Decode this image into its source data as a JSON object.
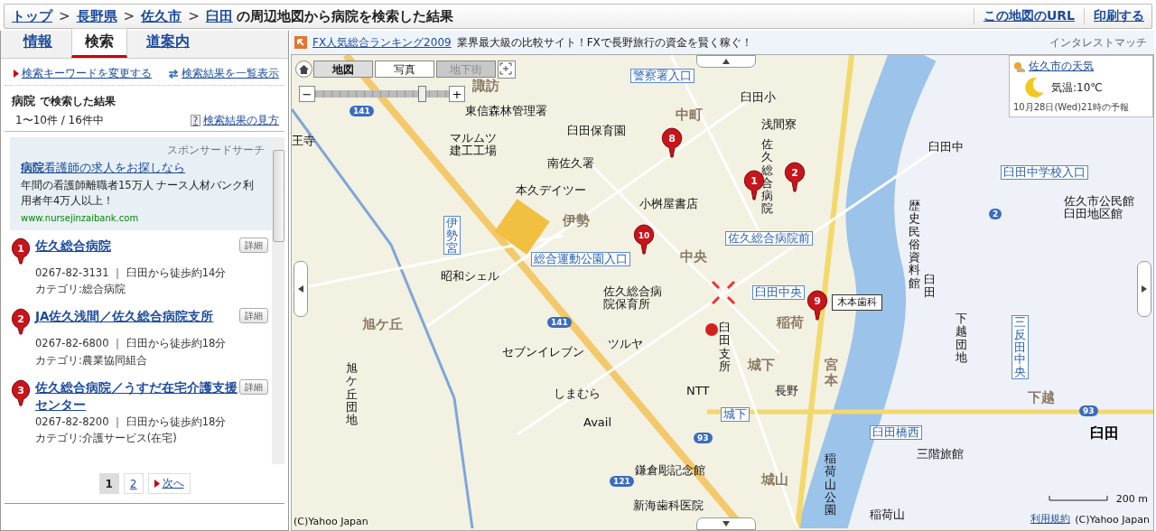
{
  "breadcrumb": {
    "crumbs": [
      {
        "kind": "link",
        "text": "トップ"
      },
      {
        "kind": "sep",
        "text": ">"
      },
      {
        "kind": "link",
        "text": "長野県"
      },
      {
        "kind": "sep",
        "text": ">"
      },
      {
        "kind": "link",
        "text": "佐久市"
      },
      {
        "kind": "sep",
        "text": ">"
      },
      {
        "kind": "link",
        "text": "臼田"
      }
    ],
    "title": "の周辺地図から病院を検索した結果",
    "links": [
      "この地図のURL",
      "印刷する"
    ]
  },
  "tabs": [
    {
      "label": "情報",
      "selected": false
    },
    {
      "label": "検索",
      "selected": true
    },
    {
      "label": "道案内",
      "selected": false
    }
  ],
  "panel_links": [
    "検索キーワードを変更する",
    "検索結果を一覧表示"
  ],
  "result_heading": {
    "keyword": "病院",
    "suffix": "で検索した結果"
  },
  "result_count": "1〜10件 / 16件中",
  "help_link": {
    "icon": "?",
    "text": "検索結果の見方"
  },
  "sponsored": {
    "label": "スポンサードサーチ",
    "title": "**病院**看護師の求人をお探しなら",
    "body": "年間の看護師離職者15万人 ナース人材バンク利用者年4万人以上！",
    "url": "www.nursejinzaibank.com"
  },
  "results": [
    {
      "number": "1",
      "name": "佐久総合病院",
      "contact": "0267-82-3131 ｜ 臼田から徒歩約14分",
      "category": "カテゴリ:総合病院",
      "detail": "詳細"
    },
    {
      "number": "2",
      "name": "JA佐久浅間／佐久総合病院支所",
      "contact": "0267-82-6800 ｜ 臼田から徒歩約18分",
      "category": "カテゴリ:農業協同組合",
      "detail": "詳細"
    },
    {
      "number": "3",
      "name": "佐久総合病院／うすだ在宅介護支援センター",
      "contact": "0267-82-8200 ｜ 臼田から徒歩約18分",
      "category": "カテゴリ:介護サービス(在宅)",
      "detail": "詳細"
    }
  ],
  "pagination": [
    {
      "label": "1",
      "selected": true,
      "kind": "page"
    },
    {
      "label": "2",
      "selected": false,
      "kind": "page"
    },
    {
      "label": "次へ",
      "selected": false,
      "kind": "next"
    }
  ],
  "ad_bar": {
    "link": "FX人気総合ランキング2009",
    "text": "業界最大級の比較サイト！FXで長野旅行の資金を賢く稼ぐ！",
    "source": "インタレストマッチ"
  },
  "map_modes": [
    {
      "label": "地図",
      "selected": true,
      "disabled": false
    },
    {
      "label": "写真",
      "selected": false,
      "disabled": false
    },
    {
      "label": "地下街",
      "selected": false,
      "disabled": true
    }
  ],
  "zoom": {
    "minus": "−",
    "plus": "+",
    "level": 0.8
  },
  "weather": {
    "link": "佐久市の天気",
    "temperature": "気温:10℃",
    "forecast": "10月28日(Wed)21時の予報"
  },
  "map_labels": [
    {
      "text": "諏訪",
      "kind": "area",
      "vertical": false
    },
    {
      "text": "警察署入口",
      "kind": "stop",
      "vertical": false
    },
    {
      "text": "中町",
      "kind": "area",
      "vertical": false
    },
    {
      "text": "東信森林管理署",
      "kind": "place",
      "vertical": false
    },
    {
      "text": "臼田小",
      "kind": "school",
      "vertical": false
    },
    {
      "text": "浅間寮",
      "kind": "place",
      "vertical": false
    },
    {
      "text": "臼田保育園",
      "kind": "place",
      "vertical": false
    },
    {
      "text": "王寺",
      "kind": "place",
      "vertical": false
    },
    {
      "text": "マルムツ建工工場",
      "kind": "place",
      "vertical": false
    },
    {
      "text": "南佐久署",
      "kind": "police",
      "vertical": false
    },
    {
      "text": "佐久総合病院",
      "kind": "place",
      "vertical": true
    },
    {
      "text": "臼田中",
      "kind": "school",
      "vertical": false
    },
    {
      "text": "本久デイツー",
      "kind": "place",
      "vertical": false
    },
    {
      "text": "小桝屋書店",
      "kind": "place",
      "vertical": false
    },
    {
      "text": "伊勢",
      "kind": "area",
      "vertical": false
    },
    {
      "text": "臼田中学校入口",
      "kind": "stop",
      "vertical": false
    },
    {
      "text": "佐久市公民館臼田地区館",
      "kind": "place",
      "vertical": false
    },
    {
      "text": "伊勢宮",
      "kind": "stop",
      "vertical": true
    },
    {
      "text": "佐久総合病院前",
      "kind": "stop",
      "vertical": false
    },
    {
      "text": "歴史民俗資料館",
      "kind": "place",
      "vertical": true
    },
    {
      "text": "臼田",
      "kind": "place",
      "vertical": true
    },
    {
      "text": "総合運動公園入口",
      "kind": "stop",
      "vertical": false
    },
    {
      "text": "中央",
      "kind": "area",
      "vertical": false
    },
    {
      "text": "昭和シェル",
      "kind": "place",
      "vertical": false
    },
    {
      "text": "佐久総合病院保育所",
      "kind": "place",
      "vertical": false
    },
    {
      "text": "臼田中央",
      "kind": "stop",
      "vertical": false
    },
    {
      "text": "旭ケ丘",
      "kind": "area",
      "vertical": false
    },
    {
      "text": "下越団地",
      "kind": "place",
      "vertical": true
    },
    {
      "text": "臼田支所",
      "kind": "place",
      "vertical": true
    },
    {
      "text": "稲荷",
      "kind": "area",
      "vertical": false
    },
    {
      "text": "セブンイレブン",
      "kind": "place",
      "vertical": false
    },
    {
      "text": "ツルヤ",
      "kind": "place",
      "vertical": false
    },
    {
      "text": "旭ケ丘団地",
      "kind": "place",
      "vertical": true
    },
    {
      "text": "城下",
      "kind": "area",
      "vertical": false
    },
    {
      "text": "宮本",
      "kind": "area",
      "vertical": true
    },
    {
      "text": "三反田中央",
      "kind": "stop",
      "vertical": true
    },
    {
      "text": "しまむら",
      "kind": "place",
      "vertical": false
    },
    {
      "text": "NTT",
      "kind": "place",
      "vertical": false
    },
    {
      "text": "長野",
      "kind": "place",
      "vertical": false
    },
    {
      "text": "下越",
      "kind": "area",
      "vertical": false
    },
    {
      "text": "臼田",
      "kind": "station",
      "vertical": false
    },
    {
      "text": "城下",
      "kind": "stop",
      "vertical": false
    },
    {
      "text": "臼田橋西",
      "kind": "stop",
      "vertical": false
    },
    {
      "text": "三階旅館",
      "kind": "place",
      "vertical": false
    },
    {
      "text": "Avail",
      "kind": "place",
      "vertical": false
    },
    {
      "text": "稲荷山公園",
      "kind": "place",
      "vertical": true
    },
    {
      "text": "鎌倉彫記念館",
      "kind": "place",
      "vertical": false
    },
    {
      "text": "城山",
      "kind": "area",
      "vertical": false
    },
    {
      "text": "新海歯科医院",
      "kind": "place",
      "vertical": false
    },
    {
      "text": "稲荷山",
      "kind": "place",
      "vertical": false
    },
    {
      "text": "木本歯科",
      "kind": "callout",
      "vertical": false
    }
  ],
  "routes": [
    "141",
    "141",
    "93",
    "93",
    "121",
    "2"
  ],
  "pins": [
    "8",
    "1",
    "2",
    "10",
    "9"
  ],
  "map_footer": {
    "copyright": "(C)Yahoo Japan",
    "scale": "200 m",
    "terms": "利用規約",
    "copyright_right": "(C)Yahoo Japan"
  }
}
